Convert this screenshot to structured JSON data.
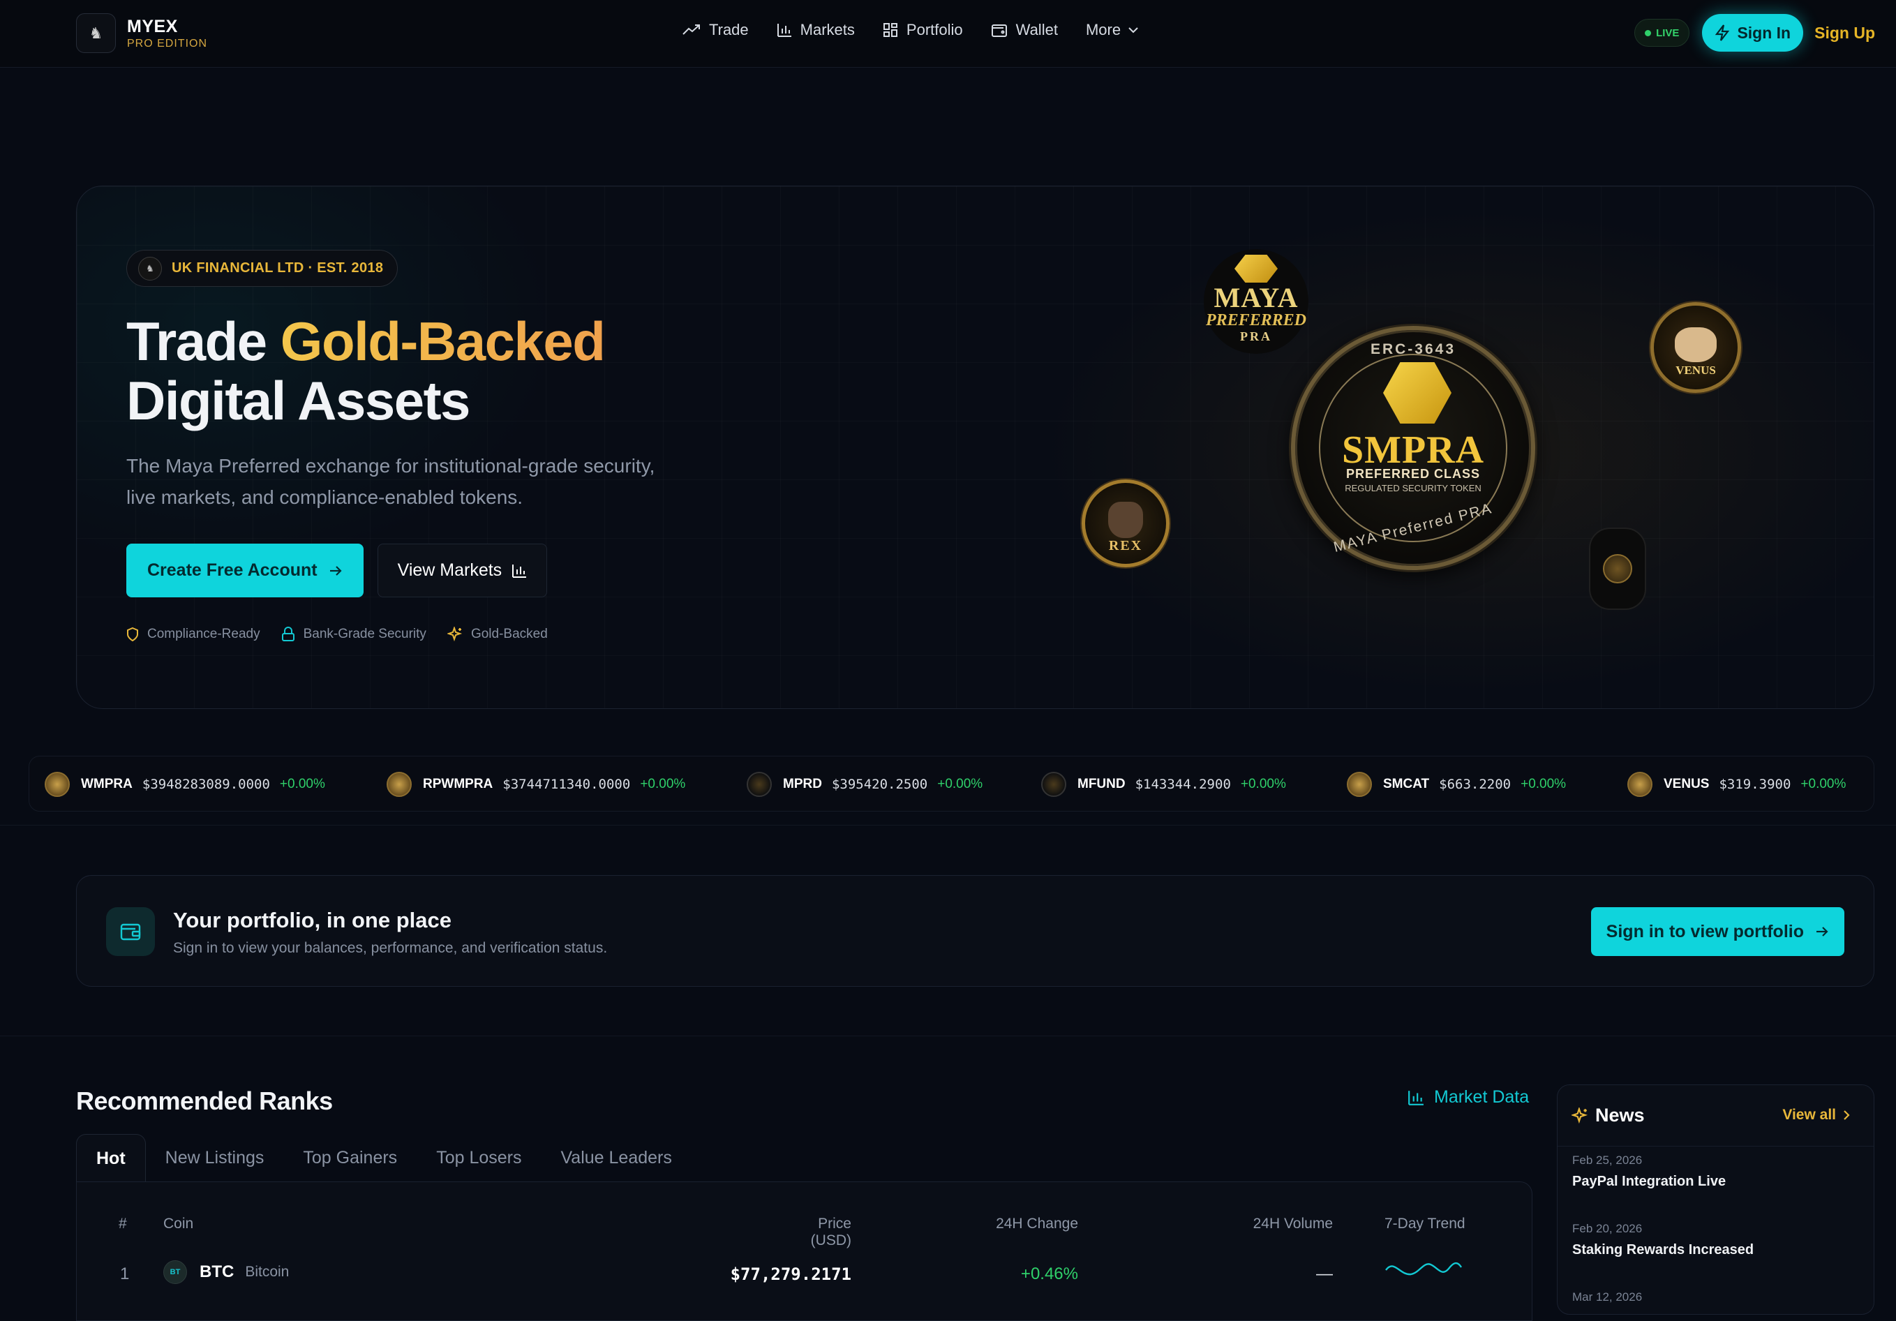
{
  "brand": {
    "name": "MYEX",
    "edition": "PRO EDITION"
  },
  "nav": {
    "items": [
      {
        "label": "Trade",
        "icon": "trending-up-icon"
      },
      {
        "label": "Markets",
        "icon": "bar-chart-icon"
      },
      {
        "label": "Portfolio",
        "icon": "grid-icon"
      },
      {
        "label": "Wallet",
        "icon": "wallet-icon"
      },
      {
        "label": "More",
        "icon": "chevron-down-icon"
      }
    ],
    "live_label": "LIVE",
    "signin_label": "Sign In",
    "signup_label": "Sign Up"
  },
  "hero": {
    "badge": "UK FINANCIAL LTD · EST. 2018",
    "title_part1": "Trade ",
    "title_highlight": "Gold-Backed",
    "title_part2": "Digital Assets",
    "subtitle": "The Maya Preferred exchange for institutional-grade security, live markets, and compliance-enabled tokens.",
    "cta_primary": "Create Free Account",
    "cta_secondary": "View Markets",
    "features": [
      "Compliance-Ready",
      "Bank-Grade Security",
      "Gold-Backed"
    ],
    "coins": {
      "maya": {
        "line1": "MAYA",
        "line2": "PREFERRED",
        "line3": "PRA"
      },
      "smpra": {
        "top": "ERC-3643",
        "name": "SMPRA",
        "class": "PREFERRED CLASS",
        "subtitle": "REGULATED SECURITY TOKEN",
        "bottom": "MAYA Preferred PRA"
      },
      "venus": {
        "label": "VENUS"
      },
      "rex": {
        "label": "REX"
      }
    }
  },
  "ticker": [
    {
      "symbol": "WMPRA",
      "price": "$3948283089.0000",
      "change": "+0.00%"
    },
    {
      "symbol": "RPWMPRA",
      "price": "$3744711340.0000",
      "change": "+0.00%"
    },
    {
      "symbol": "MPRD",
      "price": "$395420.2500",
      "change": "+0.00%"
    },
    {
      "symbol": "MFUND",
      "price": "$143344.2900",
      "change": "+0.00%"
    },
    {
      "symbol": "SMCAT",
      "price": "$663.2200",
      "change": "+0.00%"
    },
    {
      "symbol": "VENUS",
      "price": "$319.3900",
      "change": "+0.00%"
    }
  ],
  "portfolio_card": {
    "title": "Your portfolio, in one place",
    "subtitle": "Sign in to view your balances, performance, and verification status.",
    "button": "Sign in to view portfolio"
  },
  "ranks": {
    "title": "Recommended Ranks",
    "market_data_label": "Market Data",
    "tabs": [
      "Hot",
      "New Listings",
      "Top Gainers",
      "Top Losers",
      "Value Leaders"
    ],
    "columns": [
      "#",
      "Coin",
      "Price (USD)",
      "24H Change",
      "24H Volume",
      "7-Day Trend"
    ],
    "rows": [
      {
        "rank": "1",
        "chip": "BT",
        "symbol": "BTC",
        "name": "Bitcoin",
        "price": "$77,279.2171",
        "change": "+0.46%",
        "volume": "—"
      }
    ]
  },
  "news": {
    "title": "News",
    "view_all": "View all",
    "items": [
      {
        "date": "Feb 25, 2026",
        "title": "PayPal Integration Live"
      },
      {
        "date": "Feb 20, 2026",
        "title": "Staking Rewards Increased"
      },
      {
        "date": "Mar 12, 2026",
        "title": ""
      }
    ]
  },
  "colors": {
    "accent_cyan": "#0fd4dc",
    "gold": "#e8b73a",
    "positive": "#2fd06a",
    "background": "#070b14"
  }
}
